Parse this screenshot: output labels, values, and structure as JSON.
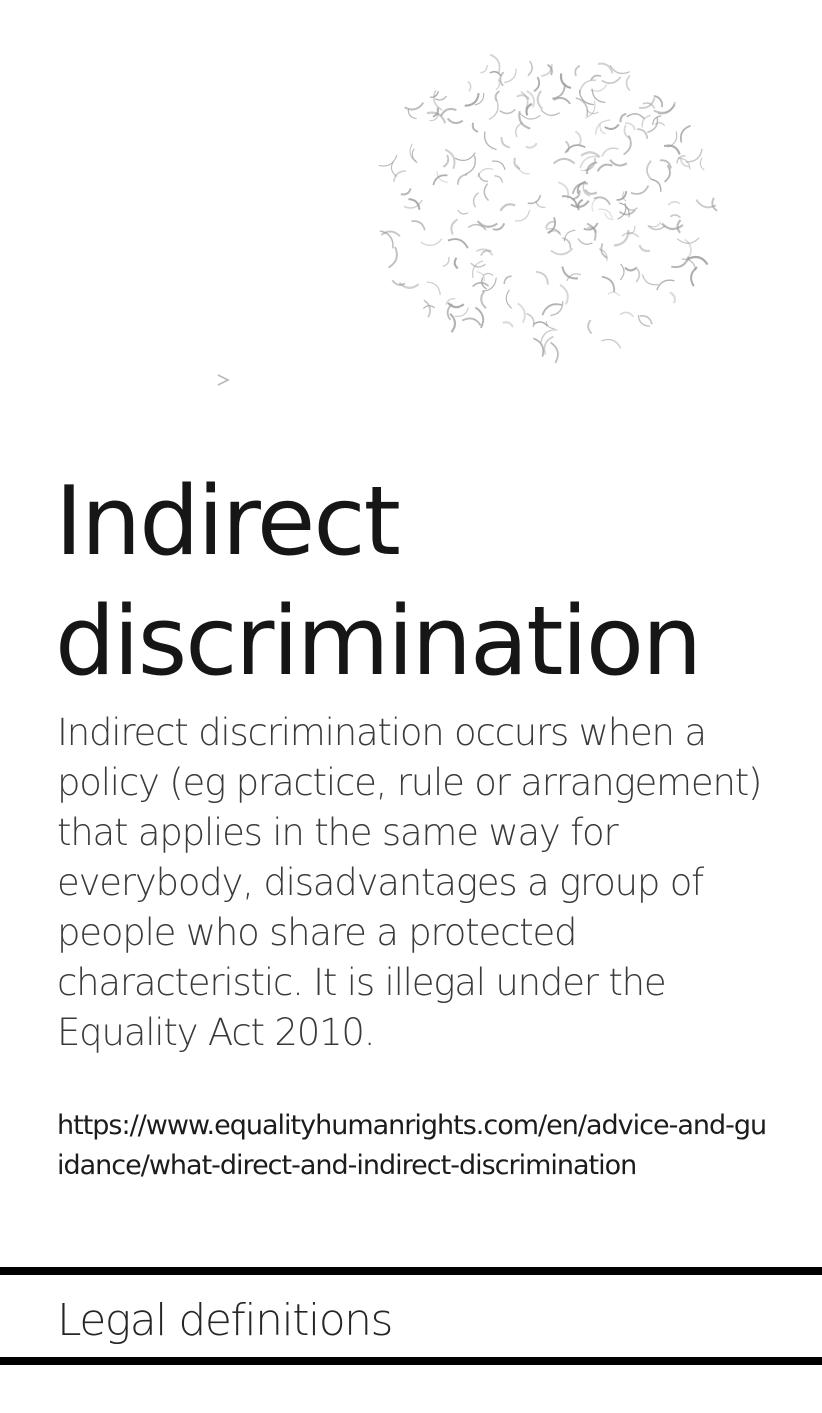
{
  "article": {
    "title_line1": "Indirect",
    "title_line2": "discrimination",
    "description": "Indirect discrimination occurs when a policy (eg practice, rule or arrangement) that applies in the same way for everybody, disadvantages a group of people who share a protected characteristic. It is illegal under the Equality Act 2010.",
    "source_url": "https://www.equalityhumanrights.com/en/advice-and-guidance/what-direct-and-indirect-discrimination"
  },
  "section": {
    "label": "Legal definitions"
  },
  "hero": {
    "illustration_icon": "bird-flock-illustration",
    "color": "#9a9a9a"
  },
  "colors": {
    "text": "#161616",
    "muted_text": "#3a3a3a",
    "rule": "#000000"
  }
}
